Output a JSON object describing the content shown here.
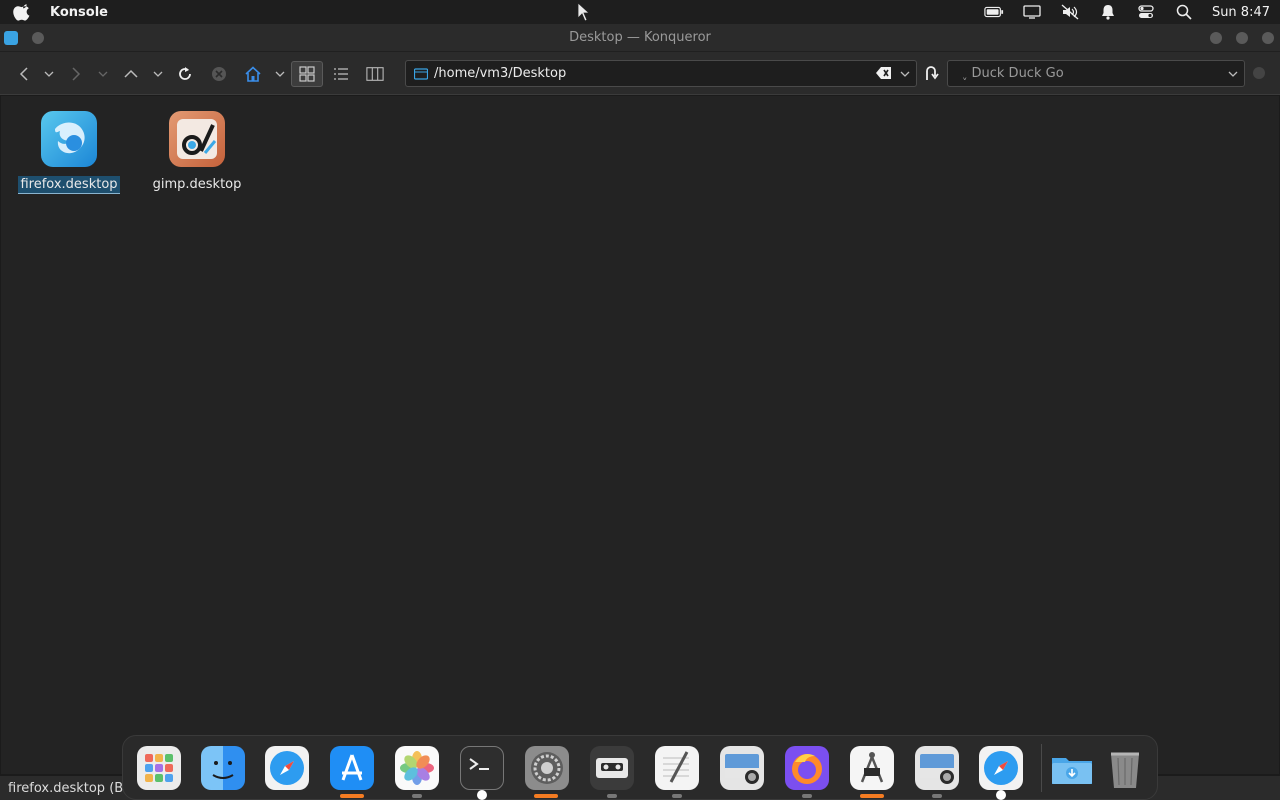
{
  "menubar": {
    "app_name": "Konsole",
    "clock": "Sun 8:47"
  },
  "window": {
    "title": "Desktop — Konqueror"
  },
  "toolbar": {
    "location": "/home/vm3/Desktop",
    "search_placeholder": "Duck Duck Go"
  },
  "files": [
    {
      "name": "firefox.desktop",
      "selected": true
    },
    {
      "name": "gimp.desktop",
      "selected": false
    }
  ],
  "statusbar": {
    "text": "firefox.desktop (Br"
  },
  "dock": {
    "items": [
      {
        "name": "launchpad-icon",
        "color": "#e9e9e9"
      },
      {
        "name": "finder-icon",
        "color": "#2f8ff0"
      },
      {
        "name": "safari-icon",
        "color": "#f2f2f2"
      },
      {
        "name": "app-store-icon",
        "color": "#1f8ef5"
      },
      {
        "name": "photos-icon",
        "color": "#fafafa"
      },
      {
        "name": "terminal-icon",
        "color": "#2e2e2e"
      },
      {
        "name": "system-settings-icon",
        "color": "#8c8c8c"
      },
      {
        "name": "cassette-icon",
        "color": "#444"
      },
      {
        "name": "textedit-icon",
        "color": "#f4f4f4"
      },
      {
        "name": "screenshot-icon",
        "color": "#e5e5e5"
      },
      {
        "name": "firefox-icon",
        "color": "#7b4ff0"
      },
      {
        "name": "compass-tool-icon",
        "color": "#f5f5f5"
      },
      {
        "name": "screenshot-2-icon",
        "color": "#e5e5e5"
      },
      {
        "name": "safari-2-icon",
        "color": "#f2f2f2"
      },
      {
        "name": "downloads-folder-icon",
        "color": "#4aa6e8"
      },
      {
        "name": "trash-icon",
        "color": "#7a7a7a"
      }
    ]
  }
}
